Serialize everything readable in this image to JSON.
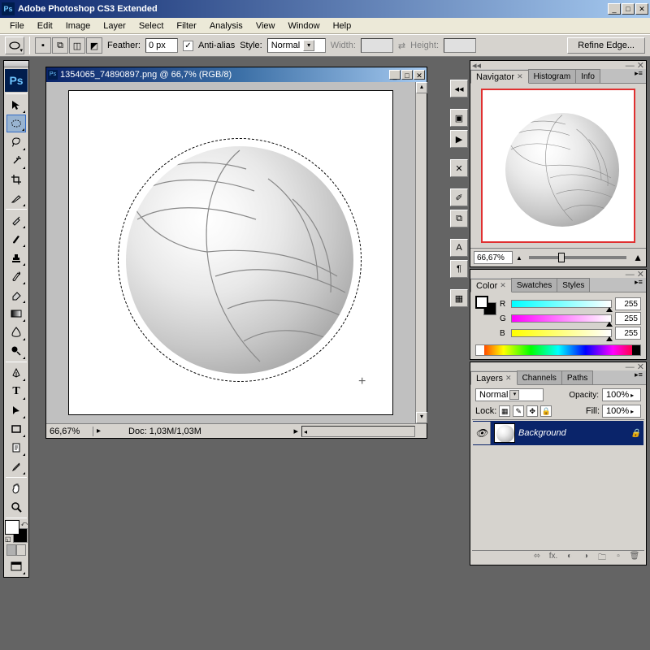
{
  "app": {
    "title": "Adobe Photoshop CS3 Extended",
    "logo": "Ps"
  },
  "menubar": [
    "File",
    "Edit",
    "Image",
    "Layer",
    "Select",
    "Filter",
    "Analysis",
    "View",
    "Window",
    "Help"
  ],
  "options": {
    "feather_label": "Feather:",
    "feather_value": "0 px",
    "antialias_label": "Anti-alias",
    "antialias_checked": "✓",
    "style_label": "Style:",
    "style_value": "Normal",
    "width_label": "Width:",
    "width_value": "",
    "height_label": "Height:",
    "height_value": "",
    "refine_edge": "Refine Edge..."
  },
  "document": {
    "title": "1354065_74890897.png @ 66,7% (RGB/8)",
    "zoom": "66,67%",
    "info": "Doc: 1,03M/1,03M"
  },
  "navigator": {
    "tabs": [
      "Navigator",
      "Histogram",
      "Info"
    ],
    "zoom": "66,67%"
  },
  "color": {
    "tabs": [
      "Color",
      "Swatches",
      "Styles"
    ],
    "channels": [
      {
        "label": "R",
        "value": "255"
      },
      {
        "label": "G",
        "value": "255"
      },
      {
        "label": "B",
        "value": "255"
      }
    ]
  },
  "layers": {
    "tabs": [
      "Layers",
      "Channels",
      "Paths"
    ],
    "blend_mode": "Normal",
    "opacity_label": "Opacity:",
    "opacity_value": "100%",
    "lock_label": "Lock:",
    "fill_label": "Fill:",
    "fill_value": "100%",
    "layer_name": "Background"
  },
  "tools": [
    "move",
    "marquee",
    "lasso",
    "wand",
    "crop",
    "slice",
    "healing",
    "brush",
    "stamp",
    "history-brush",
    "eraser",
    "gradient",
    "blur",
    "dodge",
    "pen",
    "type",
    "path-select",
    "shape",
    "notes",
    "eyedropper",
    "hand",
    "zoom"
  ]
}
